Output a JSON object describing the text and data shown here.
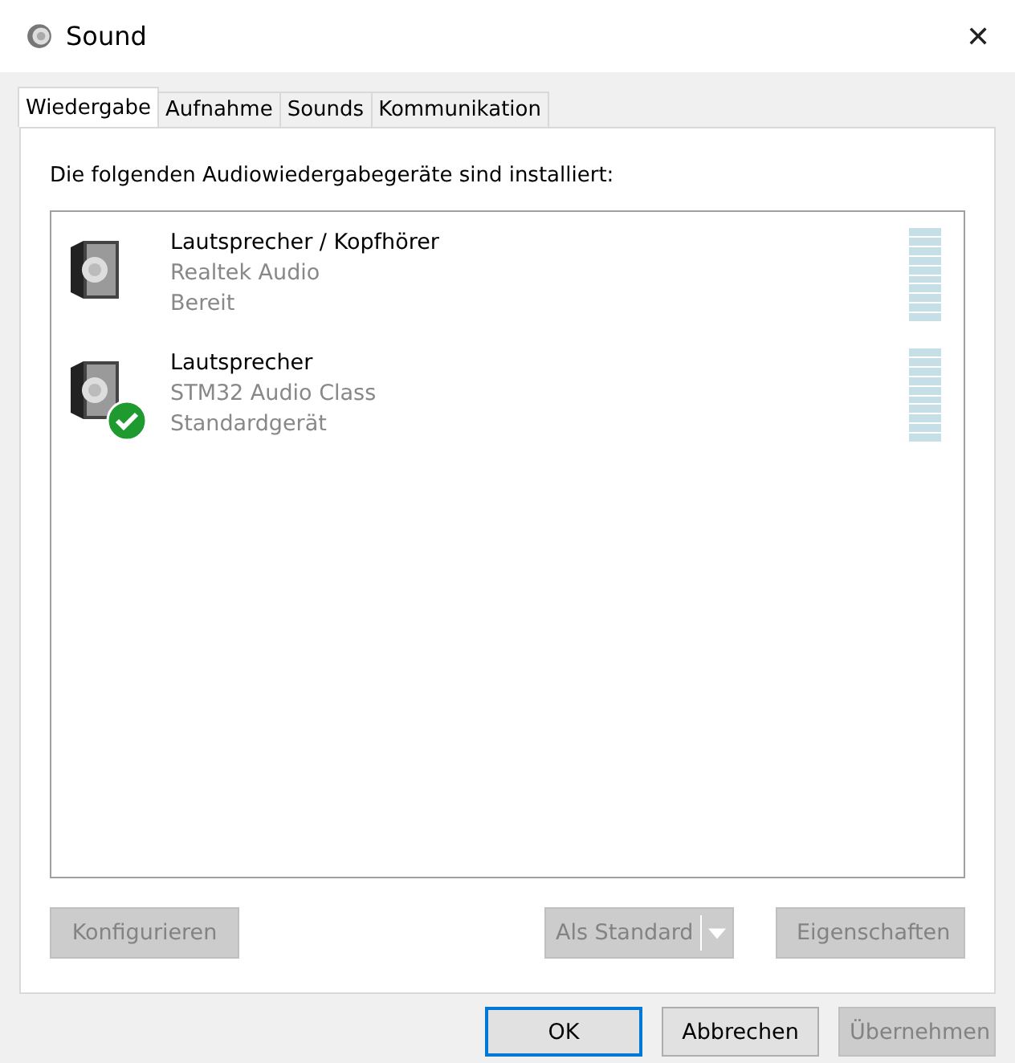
{
  "window": {
    "title": "Sound",
    "close": "✕"
  },
  "tabs": [
    {
      "label": "Wiedergabe",
      "selected": true
    },
    {
      "label": "Aufnahme",
      "selected": false
    },
    {
      "label": "Sounds",
      "selected": false
    },
    {
      "label": "Kommunikation",
      "selected": false
    }
  ],
  "intro": "Die folgenden Audiowiedergabegeräte sind installiert:",
  "devices": [
    {
      "name": "Lautsprecher / Kopfhörer",
      "driver": "Realtek Audio",
      "status": "Bereit",
      "default": false
    },
    {
      "name": "Lautsprecher",
      "driver": "STM32 Audio Class",
      "status": "Standardgerät",
      "default": true
    }
  ],
  "panel_buttons": [
    {
      "label": "Konfigurieren",
      "kind": "plain",
      "disabled": true
    },
    {
      "label": "Als Standard",
      "kind": "split",
      "disabled": true
    },
    {
      "label": "Eigenschaften",
      "kind": "plain",
      "disabled": true
    }
  ],
  "dialog_buttons": [
    {
      "label": "OK",
      "default": true,
      "disabled": false
    },
    {
      "label": "Abbrechen",
      "default": false,
      "disabled": false
    },
    {
      "label": "Übernehmen",
      "default": false,
      "disabled": true
    }
  ]
}
